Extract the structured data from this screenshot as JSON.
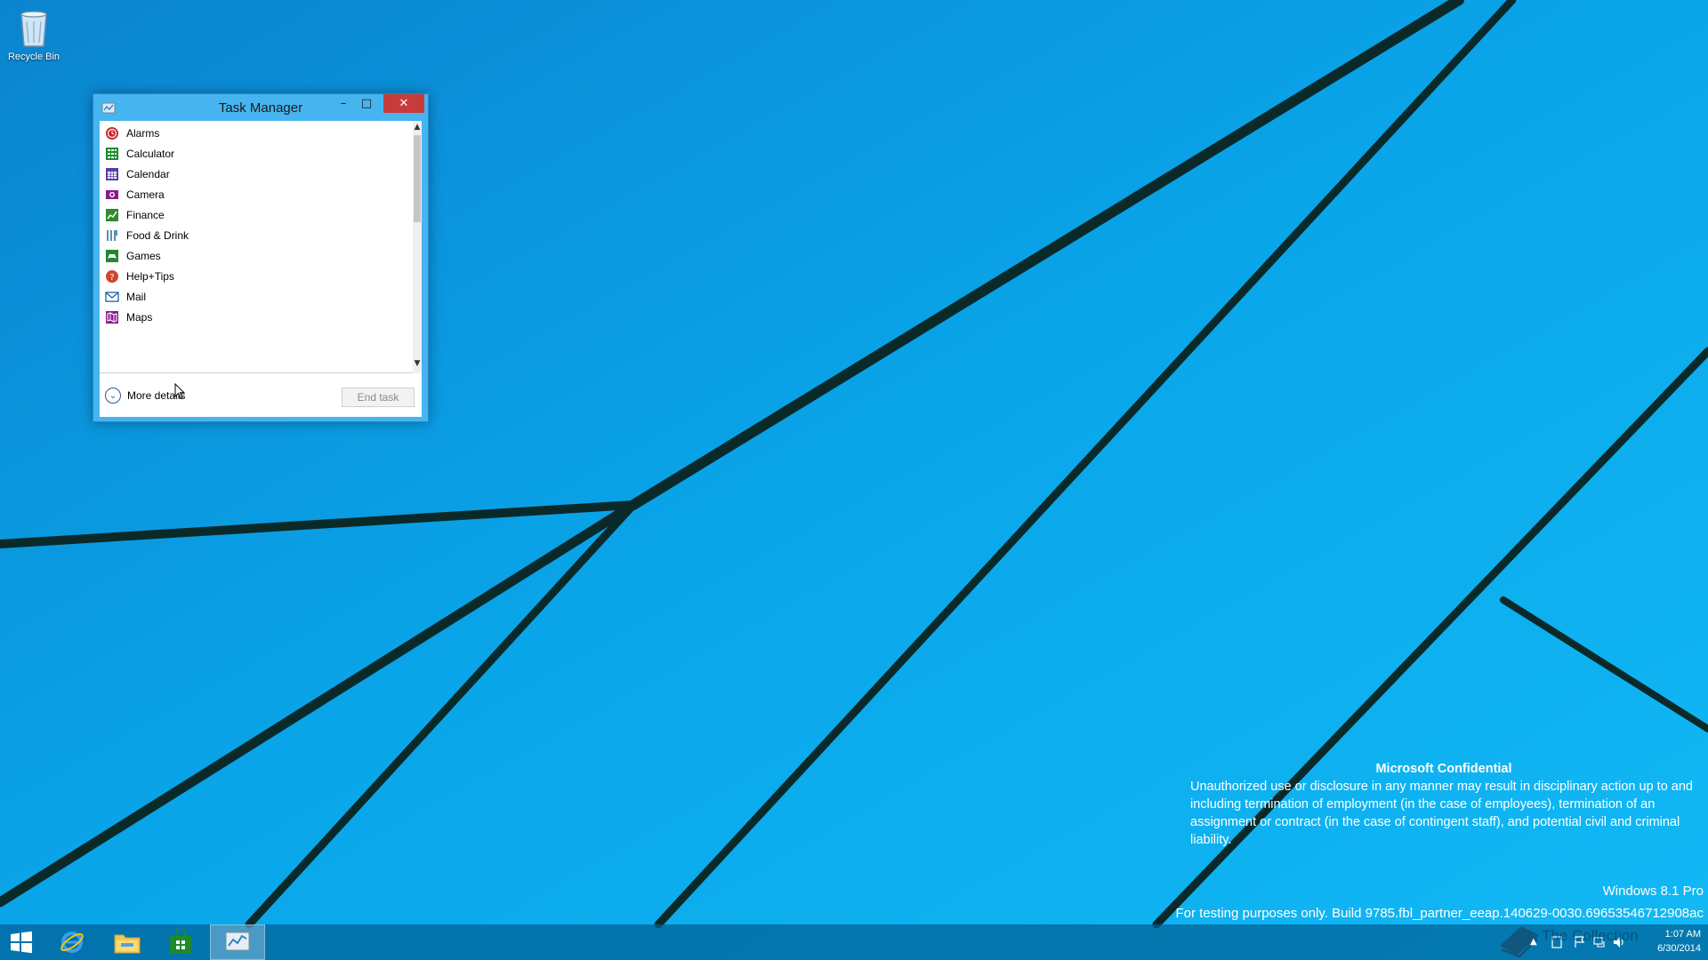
{
  "desktop": {
    "icons": [
      {
        "label": "Recycle Bin",
        "icon": "recycle-bin-icon"
      }
    ]
  },
  "task_manager": {
    "title": "Task Manager",
    "title_buttons": {
      "minimize": "–",
      "maximize": "□",
      "close": "✕"
    },
    "apps": [
      {
        "name": "Alarms",
        "icon": "alarms-icon",
        "color": "#c0272d"
      },
      {
        "name": "Calculator",
        "icon": "calculator-icon",
        "color": "#1e8a2e"
      },
      {
        "name": "Calendar",
        "icon": "calendar-icon",
        "color": "#5b3ea6"
      },
      {
        "name": "Camera",
        "icon": "camera-icon",
        "color": "#8b1a8b"
      },
      {
        "name": "Finance",
        "icon": "finance-icon",
        "color": "#2e8b2e"
      },
      {
        "name": "Food & Drink",
        "icon": "food-drink-icon",
        "color": "#2a7a9a"
      },
      {
        "name": "Games",
        "icon": "games-icon",
        "color": "#1e8a2e"
      },
      {
        "name": "Help+Tips",
        "icon": "help-tips-icon",
        "color": "#d1452b"
      },
      {
        "name": "Mail",
        "icon": "mail-icon",
        "color": "#1f5fa8"
      },
      {
        "name": "Maps",
        "icon": "maps-icon",
        "color": "#8b1a8b"
      }
    ],
    "more_details_label": "More details",
    "end_task_label": "End task",
    "end_task_enabled": false,
    "scroll_position_fraction": 0.0
  },
  "watermark": {
    "title": "Microsoft Confidential",
    "body": "Unauthorized use or disclosure in any manner may result in disciplinary action up to and including termination of employment (in the case of employees), termination of an assignment or contract (in the case of contingent staff), and potential civil and criminal liability.",
    "edition": "Windows 8.1 Pro",
    "build": "For testing purposes only. Build 9785.fbl_partner_eeap.140629-0030.69653546712908ac"
  },
  "taskbar": {
    "items": [
      {
        "name": "start-button",
        "icon": "windows-logo-icon"
      },
      {
        "name": "internet-explorer",
        "icon": "internet-explorer-icon"
      },
      {
        "name": "file-explorer",
        "icon": "folder-icon"
      },
      {
        "name": "store",
        "icon": "store-icon"
      },
      {
        "name": "task-manager",
        "icon": "task-manager-icon",
        "active": true
      }
    ],
    "clock": {
      "time": "1:07 AM",
      "date": "6/30/2014"
    },
    "overlay_text": "The Collection"
  },
  "colors": {
    "desktop_blue": "#0aa3e6",
    "window_frame": "#46b4ef",
    "close_button": "#c73c3a",
    "taskbar": "#005f96"
  }
}
